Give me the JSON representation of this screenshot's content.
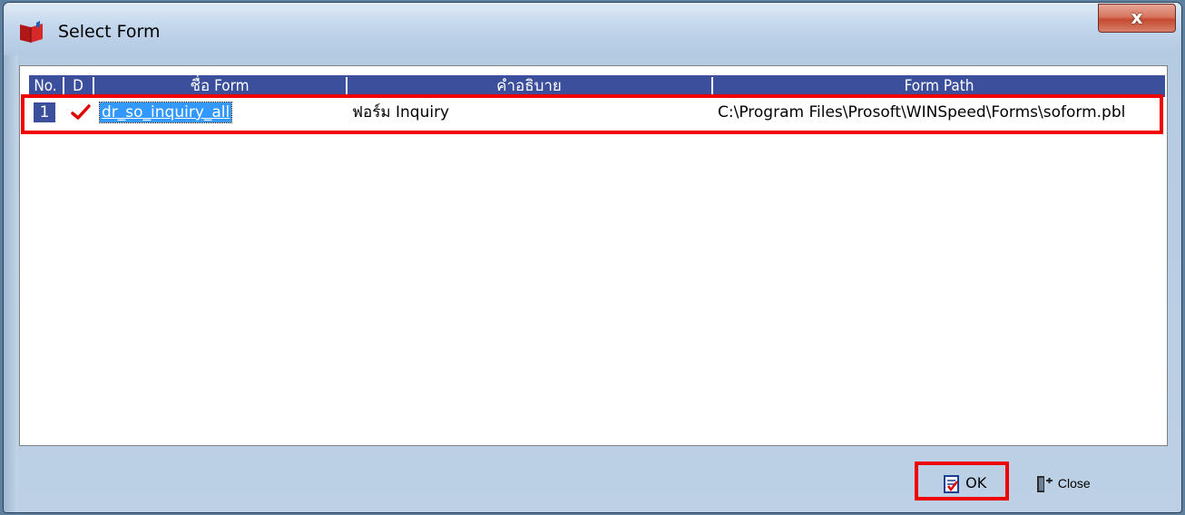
{
  "window": {
    "title": "Select Form",
    "close_label": "x"
  },
  "grid": {
    "columns": [
      "No.",
      "D",
      "ชื่อ Form",
      "คำอธิบาย",
      "Form Path"
    ],
    "rows": [
      {
        "no": "1",
        "d": "✔",
        "form_name": "dr_so_inquiry_all",
        "description": "ฟอร์ม Inquiry",
        "form_path": "C:\\Program Files\\Prosoft\\WINSpeed\\Forms\\soform.pbl"
      }
    ]
  },
  "buttons": {
    "ok": "OK",
    "close": "Close"
  },
  "colors": {
    "header_bg": "#3b4f9c",
    "selection": "#3399ff",
    "highlight": "#ee0000",
    "check": "#e00000"
  }
}
